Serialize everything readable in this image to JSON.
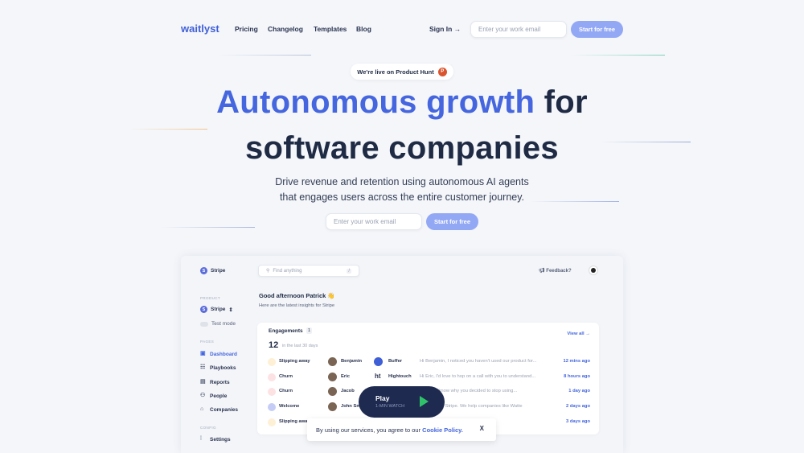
{
  "nav": {
    "logo": "waitlyst",
    "links": [
      "Pricing",
      "Changelog",
      "Templates",
      "Blog"
    ],
    "sign_in": "Sign In →",
    "email_placeholder": "Enter your work email",
    "cta": "Start for free"
  },
  "badge": {
    "text": "We're live on Product Hunt",
    "icon": "P"
  },
  "hero": {
    "title_highlight": "Autonomous growth",
    "title_rest": " for",
    "title_line2": "software companies",
    "subtitle_1": "Drive revenue and retention using autonomous AI agents",
    "subtitle_2": "that engages users across the entire customer journey.",
    "email_placeholder": "Enter your work email",
    "cta": "Start for free"
  },
  "dashboard": {
    "brand": "Stripe",
    "search_placeholder": "Find anything",
    "search_shortcut": "/",
    "feedback": "Feedback?",
    "sidebar": {
      "product_label": "PRODUCT",
      "product": "Stripe",
      "test_mode": "Test mode",
      "pages_label": "PAGES",
      "pages": [
        {
          "label": "Dashboard",
          "icon": "dashboard-icon",
          "active": true
        },
        {
          "label": "Playbooks",
          "icon": "playbooks-icon"
        },
        {
          "label": "Reports",
          "icon": "reports-icon"
        },
        {
          "label": "People",
          "icon": "people-icon"
        },
        {
          "label": "Companies",
          "icon": "companies-icon"
        }
      ],
      "config_label": "CONFIG",
      "settings": "Settings"
    },
    "greeting": "Good afternoon Patrick 👋",
    "greeting_sub": "Here are the latest insights for Stripe",
    "engagements": {
      "title": "Engagements",
      "count_badge": "1",
      "total": "12",
      "period": "in the last 30 days",
      "view_all": "View all →",
      "rows": [
        {
          "stage": "Slipping away",
          "color": "#fdf0d5",
          "person": "Benjamin",
          "company": "Buffer",
          "company_icon": "buffer-icon",
          "message": "Hi Benjamin, I noticed you haven't used our product for...",
          "time": "12 mins ago"
        },
        {
          "stage": "Churn",
          "color": "#fde2e4",
          "person": "Eric",
          "company": "Hightouch",
          "company_icon": "ht",
          "message": "Hi Eric, I'd love to hop on a call with you to understand...",
          "time": "8 hours ago"
        },
        {
          "stage": "Churn",
          "color": "#fde2e4",
          "person": "Jacob",
          "company": "",
          "company_icon": "",
          "message": "...love to know why you decided to stop using...",
          "time": "1 day ago"
        },
        {
          "stage": "Welcome",
          "color": "#c5cdf7",
          "person": "John Sm",
          "company": "",
          "company_icon": "",
          "message": "...elcome to Stripe. We help companies like Watte",
          "time": "2 days ago"
        },
        {
          "stage": "Slipping away",
          "color": "#fdf0d5",
          "person": "",
          "company": "",
          "company_icon": "",
          "message": "...help using Stripe...",
          "time": "3 days ago"
        }
      ]
    }
  },
  "play": {
    "label": "Play",
    "sub": "1-MIN WATCH"
  },
  "cookie": {
    "text": "By using our services, you agree to our ",
    "link": "Cookie Policy.",
    "close": "X"
  }
}
